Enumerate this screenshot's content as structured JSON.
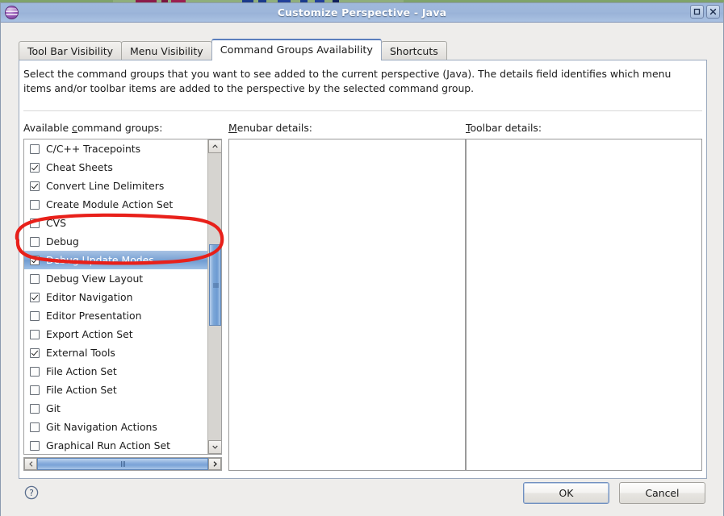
{
  "window": {
    "title": "Customize Perspective - Java",
    "icon": "eclipse-sphere-icon",
    "buttons": {
      "maximize": "maximize-icon",
      "close": "close-icon"
    }
  },
  "tabs": [
    {
      "label": "Tool Bar Visibility",
      "active": false
    },
    {
      "label": "Menu Visibility",
      "active": false
    },
    {
      "label": "Command Groups Availability",
      "active": true
    },
    {
      "label": "Shortcuts",
      "active": false
    }
  ],
  "panel": {
    "description_part1": "Select the command groups that you want to see added to the current perspective (Java).  The details field identifies which menu items and/or toolbar items are added to the perspective by the selected command group.",
    "columns": {
      "available_pre": "Available ",
      "available_mnemonic": "c",
      "available_post": "ommand groups:",
      "menubar_mnemonic": "M",
      "menubar_post": "enubar details:",
      "toolbar_mnemonic": "T",
      "toolbar_post": "oolbar details:"
    }
  },
  "list": {
    "items": [
      {
        "label": "C/C++ Tracepoints",
        "checked": false,
        "selected": false
      },
      {
        "label": "Cheat Sheets",
        "checked": true,
        "selected": false
      },
      {
        "label": "Convert Line Delimiters",
        "checked": true,
        "selected": false
      },
      {
        "label": "Create Module Action Set",
        "checked": false,
        "selected": false
      },
      {
        "label": "CVS",
        "checked": false,
        "selected": false
      },
      {
        "label": "Debug",
        "checked": false,
        "selected": false
      },
      {
        "label": "Debug Update Modes",
        "checked": true,
        "selected": true
      },
      {
        "label": "Debug View Layout",
        "checked": false,
        "selected": false
      },
      {
        "label": "Editor Navigation",
        "checked": true,
        "selected": false
      },
      {
        "label": "Editor Presentation",
        "checked": false,
        "selected": false
      },
      {
        "label": "Export Action Set",
        "checked": false,
        "selected": false
      },
      {
        "label": "External Tools",
        "checked": true,
        "selected": false
      },
      {
        "label": "File Action Set",
        "checked": false,
        "selected": false
      },
      {
        "label": "File Action Set",
        "checked": false,
        "selected": false
      },
      {
        "label": "Git",
        "checked": false,
        "selected": false
      },
      {
        "label": "Git Navigation Actions",
        "checked": false,
        "selected": false
      },
      {
        "label": "Graphical Run Action Set",
        "checked": false,
        "selected": false
      }
    ]
  },
  "details": {
    "menubar_content": "",
    "toolbar_content": ""
  },
  "footer": {
    "help": "help-icon",
    "ok_label": "OK",
    "cancel_label": "Cancel"
  },
  "annotation": {
    "shape": "red-ellipse-highlight",
    "color": "#e8201a",
    "target": "Debug Update Modes"
  },
  "colors": {
    "titlebar": "#9db6da",
    "selection": "#7ba3d4",
    "accent": "#5b7fbd",
    "desktop": "#6b8e5a"
  }
}
